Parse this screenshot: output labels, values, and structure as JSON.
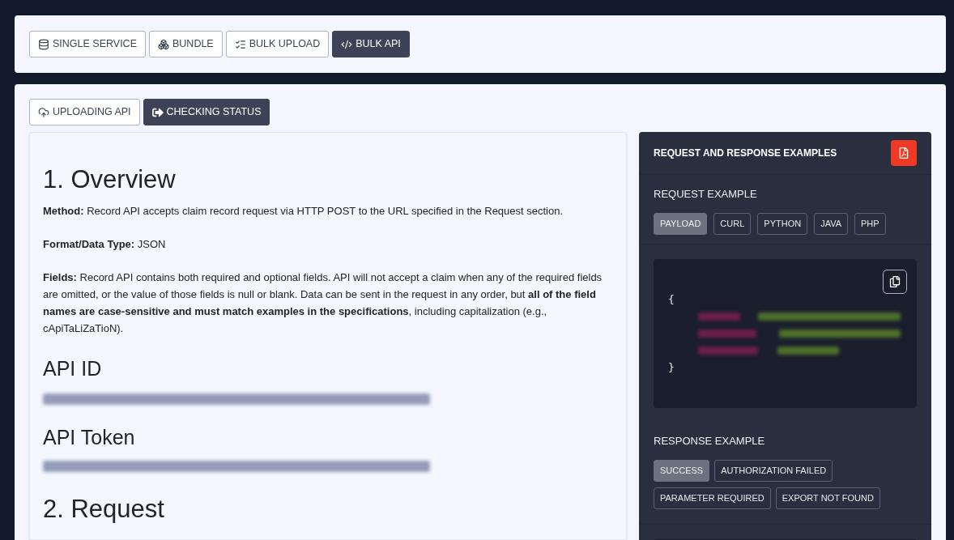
{
  "mode_tabs": [
    {
      "label": "SINGLE SERVICE",
      "selected": false
    },
    {
      "label": "BUNDLE",
      "selected": false
    },
    {
      "label": "BULK UPLOAD",
      "selected": false
    },
    {
      "label": "BULK API",
      "selected": true
    }
  ],
  "api_tabs": [
    {
      "label": "UPLOADING API",
      "selected": false
    },
    {
      "label": "CHECKING STATUS",
      "selected": true
    }
  ],
  "document": {
    "overview_heading": "1. Overview",
    "paragraphs": [
      "**Method:** Record API accepts claim record request via HTTP POST to the URL specified in the Request section.",
      "**Format/Data Type:** JSON",
      "**Fields:** Record API contains both required and optional fields. API will not accept a claim when any of the required fields are omitted, or the value of those fields is null or blank. Data can be sent in the request in any order, but **all of the field names are case-sensitive and must match examples in the specifications**, including capitalization (e.g., cApiTaLiZaTioN)."
    ],
    "api_id": {
      "label": "API ID"
    },
    "api_token": {
      "label": "API Token"
    },
    "request_heading": "2. Request"
  },
  "examples": {
    "title": "REQUEST AND RESPONSE EXAMPLES",
    "request": {
      "heading": "REQUEST EXAMPLE",
      "formats": [
        {
          "label": "PAYLOAD",
          "selected": true
        },
        {
          "label": "CURL",
          "selected": false
        },
        {
          "label": "PYTHON",
          "selected": false
        },
        {
          "label": "JAVA",
          "selected": false
        },
        {
          "label": "PHP",
          "selected": false
        }
      ],
      "code": {
        "open": "{",
        "close": "}"
      }
    },
    "response": {
      "heading": "RESPONSE EXAMPLE",
      "cases": [
        {
          "label": "SUCCESS",
          "selected": true
        },
        {
          "label": "AUTHORIZATION FAILED",
          "selected": false
        },
        {
          "label": "PARAMETER REQUIRED",
          "selected": false
        },
        {
          "label": "EXPORT NOT FOUND",
          "selected": false
        }
      ]
    }
  }
}
